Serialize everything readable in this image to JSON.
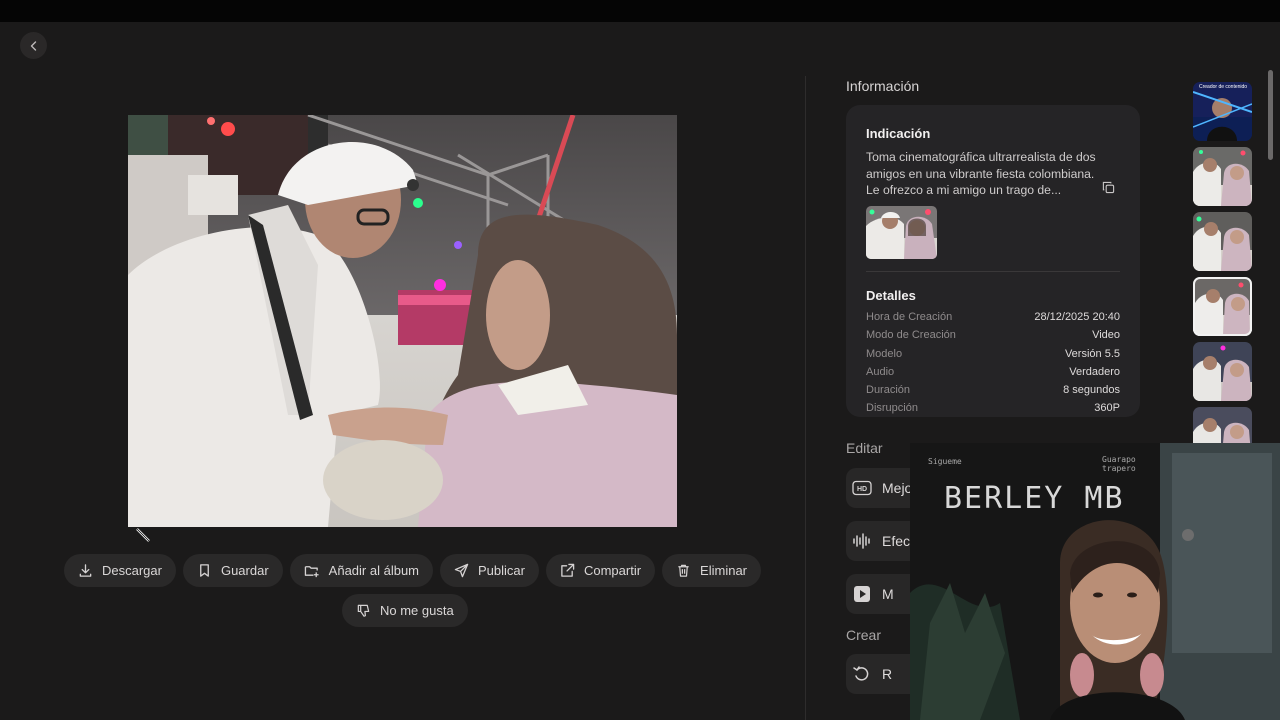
{
  "info": {
    "title": "Información",
    "indication_heading": "Indicación",
    "prompt": "Toma cinematográfica ultrarrealista de dos amigos en una vibrante fiesta colombiana. Le ofrezco a mi amigo un trago de...",
    "details_heading": "Detalles",
    "details": [
      {
        "key": "Hora de Creación",
        "value": "28/12/2025 20:40"
      },
      {
        "key": "Modo de Creación",
        "value": "Video"
      },
      {
        "key": "Modelo",
        "value": "Versión 5.5"
      },
      {
        "key": "Audio",
        "value": "Verdadero"
      },
      {
        "key": "Duración",
        "value": "8 segundos"
      },
      {
        "key": "Disrupción",
        "value": "360P"
      }
    ]
  },
  "edit": {
    "label": "Editar",
    "buttons": [
      {
        "label": "Mejo",
        "icon": "hd-icon"
      },
      {
        "label": "Efect",
        "icon": "waveform-icon"
      },
      {
        "label": "M",
        "icon": "music-video-icon"
      }
    ]
  },
  "create": {
    "label": "Crear",
    "button": {
      "label": "R",
      "icon": "refresh-icon"
    }
  },
  "actions": [
    {
      "label": "Descargar",
      "icon": "download-icon"
    },
    {
      "label": "Guardar",
      "icon": "bookmark-icon"
    },
    {
      "label": "Añadir al álbum",
      "icon": "add-to-album-icon"
    },
    {
      "label": "Publicar",
      "icon": "send-icon"
    },
    {
      "label": "Compartir",
      "icon": "share-icon"
    },
    {
      "label": "Eliminar",
      "icon": "trash-icon"
    }
  ],
  "actions_row2": [
    {
      "label": "No me gusta",
      "icon": "thumbs-down-icon"
    }
  ],
  "thumbnails": {
    "first_caption": "Creador de contenido",
    "selected_index": 3
  },
  "webcam": {
    "wall_text": "BERLEY MB",
    "small_left": "Sigueme",
    "small_right": "Guarapo trapero"
  },
  "colors": {
    "background": "#1b1a1a",
    "card": "#252426",
    "pill": "#2a2929"
  }
}
